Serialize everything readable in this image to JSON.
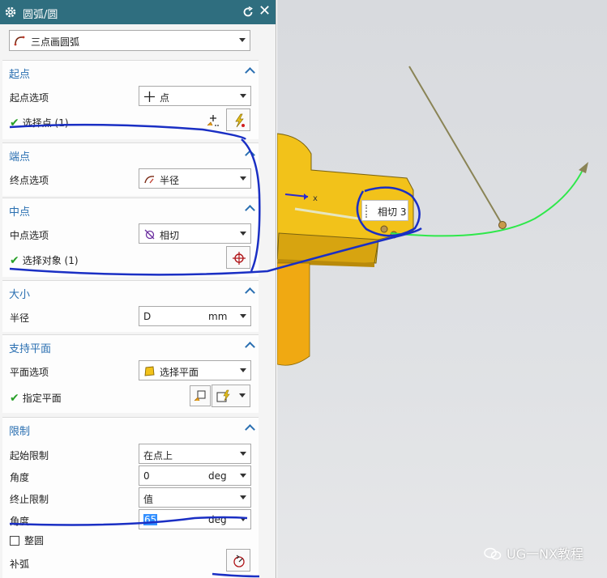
{
  "dialog": {
    "title": "圆弧/圆",
    "type_value": "三点画圆弧"
  },
  "start_point": {
    "header": "起点",
    "option_label": "起点选项",
    "option_value": "点",
    "select_text": "选择点 (1)"
  },
  "end_point": {
    "header": "端点",
    "option_label": "终点选项",
    "option_value": "半径"
  },
  "mid_point": {
    "header": "中点",
    "option_label": "中点选项",
    "option_value": "相切",
    "select_text": "选择对象 (1)"
  },
  "size": {
    "header": "大小",
    "radius_label": "半径",
    "radius_value": "D",
    "radius_unit": "mm"
  },
  "support_plane": {
    "header": "支持平面",
    "option_label": "平面选项",
    "option_value": "选择平面",
    "specify_text": "指定平面"
  },
  "limits": {
    "header": "限制",
    "start_label": "起始限制",
    "start_value": "在点上",
    "angle1_label": "角度",
    "angle1_value": "0",
    "angle1_unit": "deg",
    "end_label": "终止限制",
    "end_value": "值",
    "angle2_label": "角度",
    "angle2_value": "65",
    "angle2_unit": "deg",
    "full_circle_label": "整圆",
    "full_circle_checked": false,
    "complement_label": "补弧"
  },
  "viewport": {
    "tooltip": "相切 3"
  },
  "watermark": "UG一NX教程",
  "colors": {
    "titlebar": "#2f6e7f",
    "group_header": "#2a6fb1",
    "check_mark": "#28a028",
    "part_yellow": "#f2c21a",
    "arc_green": "#2ee84a",
    "annotation_blue": "#1a2fc4"
  }
}
